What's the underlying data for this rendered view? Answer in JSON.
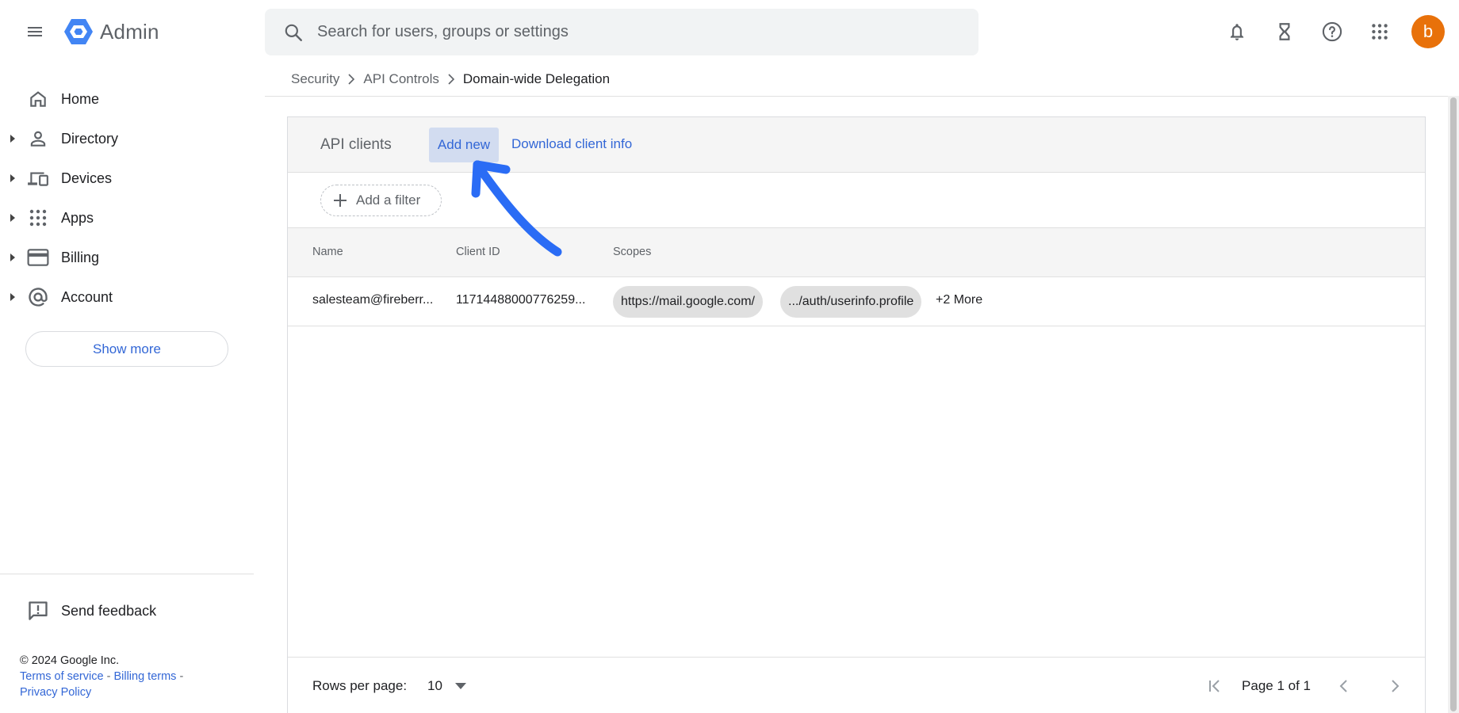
{
  "app": {
    "name": "Admin",
    "brand_color": "#4285f4",
    "accent_link": "#3367d6"
  },
  "search": {
    "placeholder": "Search for users, groups or settings",
    "value": ""
  },
  "topbar_icons": [
    "menu-icon",
    "search-icon",
    "bell-icon",
    "hourglass-icon",
    "help-icon",
    "apps-grid-icon"
  ],
  "user": {
    "avatar_letter": "b",
    "avatar_color": "#e8710a"
  },
  "sidebar": {
    "items": [
      {
        "label": "Home",
        "icon": "home-icon",
        "expandable": false
      },
      {
        "label": "Directory",
        "icon": "person-icon",
        "expandable": true
      },
      {
        "label": "Devices",
        "icon": "devices-icon",
        "expandable": true
      },
      {
        "label": "Apps",
        "icon": "apps-grid-icon",
        "expandable": true
      },
      {
        "label": "Billing",
        "icon": "credit-card-icon",
        "expandable": true
      },
      {
        "label": "Account",
        "icon": "at-sign-icon",
        "expandable": true
      }
    ],
    "show_more": "Show more",
    "feedback": "Send feedback",
    "footer": {
      "copyright": "© 2024 Google Inc.",
      "terms": "Terms of service",
      "billing_terms": "Billing terms",
      "privacy": "Privacy Policy",
      "separator": "-"
    }
  },
  "breadcrumb": {
    "items": [
      "Security",
      "API Controls",
      "Domain-wide Delegation"
    ]
  },
  "panel": {
    "title": "API clients",
    "add_new": "Add new",
    "download": "Download client info",
    "filter": "Add a filter",
    "columns": [
      "Name",
      "Client ID",
      "Scopes"
    ],
    "rows": [
      {
        "name": "salesteam@fireberr...",
        "client_id": "11714488000776259...",
        "scopes": [
          "https://mail.google.com/",
          ".../auth/userinfo.profile"
        ],
        "more": "+2 More"
      }
    ],
    "pagination": {
      "rows_per_page_label": "Rows per page:",
      "rows_per_page": "10",
      "page_label": "Page 1 of 1"
    }
  },
  "annotation": {
    "arrow_color": "#2a6cf5"
  }
}
